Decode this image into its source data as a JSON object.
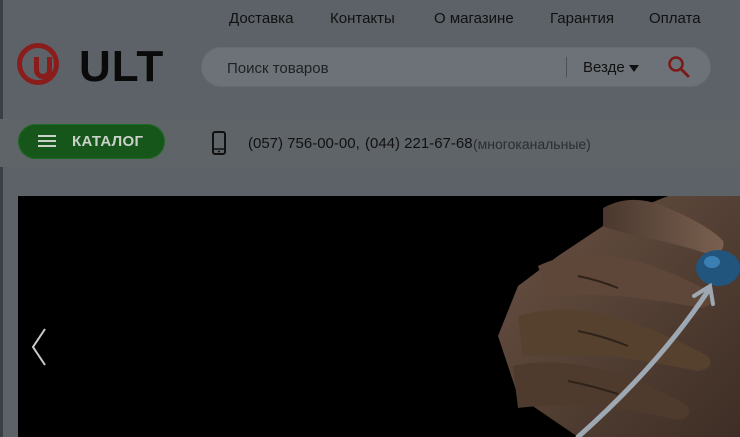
{
  "topnav": {
    "items": [
      "Доставка",
      "Контакты",
      "О магазине",
      "Гарантия",
      "Оплата"
    ]
  },
  "logo": {
    "text": "ULT",
    "icon": "ult-logo-icon",
    "brand_color": "#8a1c1c"
  },
  "search": {
    "placeholder": "Поиск товаров",
    "value": "",
    "scope": "Везде",
    "icon": "search-icon",
    "icon_color": "#7a1a1a"
  },
  "catalog": {
    "label": "КАТАЛОГ",
    "icon": "hamburger-icon",
    "color": "#17561a"
  },
  "contacts": {
    "icon": "phone-icon",
    "phone1": "(057) 756-00-00,",
    "phone2": "(044) 221-67-68",
    "note": "(многоканальные)"
  },
  "banner": {
    "prev_icon": "chevron-left-icon",
    "image": "hand-drawing-rising-arrow"
  }
}
